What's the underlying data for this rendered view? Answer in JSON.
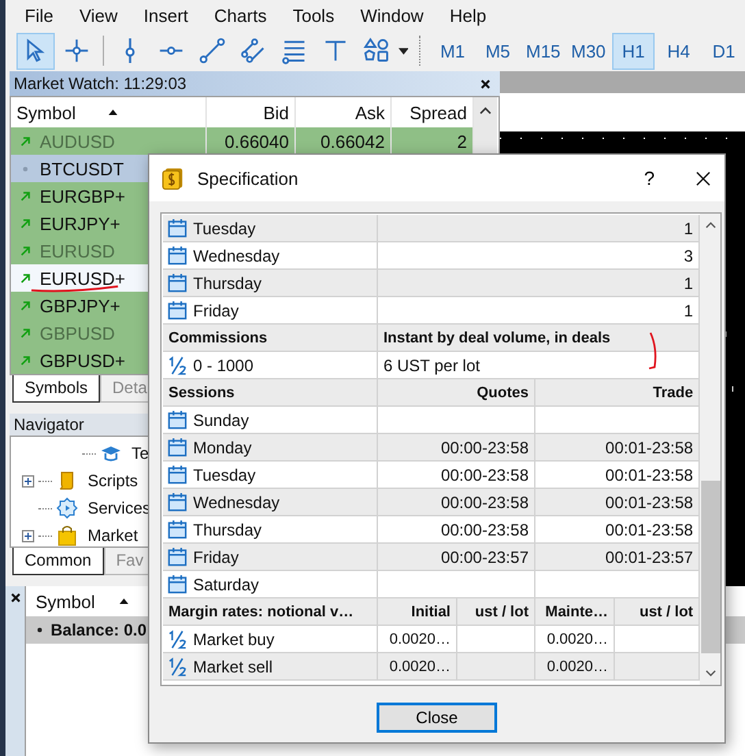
{
  "menu": [
    "File",
    "View",
    "Insert",
    "Charts",
    "Tools",
    "Window",
    "Help"
  ],
  "toolbar": {
    "tools": [
      {
        "kind": "cursor",
        "selected": true
      },
      {
        "kind": "crosshair",
        "selected": false
      },
      {
        "kind": "vline",
        "selected": false
      },
      {
        "kind": "hline",
        "selected": false
      },
      {
        "kind": "trend",
        "selected": false
      },
      {
        "kind": "channel",
        "selected": false
      },
      {
        "kind": "levels",
        "selected": false
      },
      {
        "kind": "text",
        "selected": false
      },
      {
        "kind": "shapes",
        "selected": false
      }
    ],
    "timeframes": [
      {
        "label": "M1",
        "selected": false
      },
      {
        "label": "M5",
        "selected": false
      },
      {
        "label": "M15",
        "selected": false
      },
      {
        "label": "M30",
        "selected": false
      },
      {
        "label": "H1",
        "selected": true
      },
      {
        "label": "H4",
        "selected": false
      },
      {
        "label": "D1",
        "selected": false
      }
    ]
  },
  "market_watch": {
    "title": "Market Watch: 11:29:03",
    "columns": [
      "Symbol",
      "Bid",
      "Ask",
      "Spread"
    ],
    "rows": [
      {
        "symbol": "AUDUSD",
        "kind": "up",
        "disabled": true,
        "color": "#8fbf86",
        "bid": "0.66040",
        "ask": "0.66042",
        "spread": "2"
      },
      {
        "symbol": "BTCUSDT",
        "kind": "dot",
        "disabled": false,
        "color": "#b7c9df"
      },
      {
        "symbol": "EURGBP+",
        "kind": "up",
        "disabled": false,
        "color": "#8fbf86"
      },
      {
        "symbol": "EURJPY+",
        "kind": "up",
        "disabled": false,
        "color": "#8fbf86"
      },
      {
        "symbol": "EURUSD",
        "kind": "up",
        "disabled": true,
        "color": "#8fbf86"
      },
      {
        "symbol": "EURUSD+",
        "kind": "up",
        "disabled": false,
        "color": "#f3f7fc",
        "annotated": true
      },
      {
        "symbol": "GBPJPY+",
        "kind": "up",
        "disabled": false,
        "color": "#8fbf86"
      },
      {
        "symbol": "GBPUSD",
        "kind": "up",
        "disabled": true,
        "color": "#8fbf86"
      },
      {
        "symbol": "GBPUSD+",
        "kind": "up",
        "disabled": false,
        "color": "#8fbf86"
      }
    ],
    "tabs": [
      {
        "label": "Symbols",
        "selected": true
      },
      {
        "label": "Deta",
        "selected": false
      }
    ]
  },
  "navigator": {
    "title": "Navigator",
    "items": [
      {
        "label": "Te",
        "kind": "cap"
      },
      {
        "label": "Scripts",
        "kind": "scroll",
        "expanded": false
      },
      {
        "label": "Services",
        "kind": "gear"
      },
      {
        "label": "Market",
        "kind": "bag",
        "expanded": false
      }
    ],
    "tabs": [
      {
        "label": "Common",
        "selected": true
      },
      {
        "label": "Fav",
        "selected": false
      }
    ]
  },
  "toolbox": {
    "columns": [
      "Symbol"
    ],
    "rows": [
      "Balance: 0.0"
    ]
  },
  "dialog": {
    "title": "Specification",
    "help": "?",
    "sections": [
      {
        "kind": "schedule",
        "rows": [
          {
            "label": "Tuesday",
            "values": [
              "1"
            ]
          },
          {
            "label": "Wednesday",
            "values": [
              "3"
            ]
          },
          {
            "label": "Thursday",
            "values": [
              "1"
            ]
          },
          {
            "label": "Friday",
            "values": [
              "1"
            ]
          }
        ]
      },
      {
        "kind": "commissions",
        "heading": [
          "Commissions",
          "Instant by deal volume, in deals"
        ],
        "annotated": true,
        "rows": [
          {
            "label": "0 - 1000",
            "values": [
              "6 UST per lot"
            ]
          }
        ]
      },
      {
        "kind": "sessions",
        "heading": [
          "Sessions",
          "Quotes",
          "Trade"
        ],
        "rows": [
          {
            "label": "Sunday"
          },
          {
            "label": "Monday",
            "values": [
              "00:00-23:58",
              "00:01-23:58"
            ]
          },
          {
            "label": "Tuesday",
            "values": [
              "00:00-23:58",
              "00:01-23:58"
            ]
          },
          {
            "label": "Wednesday",
            "values": [
              "00:00-23:58",
              "00:01-23:58"
            ]
          },
          {
            "label": "Thursday",
            "values": [
              "00:00-23:58",
              "00:01-23:58"
            ]
          },
          {
            "label": "Friday",
            "values": [
              "00:00-23:57",
              "00:01-23:57"
            ]
          },
          {
            "label": "Saturday"
          }
        ]
      },
      {
        "kind": "margin",
        "heading": [
          "Margin rates: notional v…",
          "Initial",
          "ust / lot",
          "Mainte…",
          "ust / lot"
        ],
        "rows": [
          {
            "label": "Market buy",
            "initial": "0.0020…",
            "maintenance": "0.0020…"
          },
          {
            "label": "Market sell",
            "initial": "0.0020…",
            "maintenance": "0.0020…"
          }
        ]
      }
    ],
    "button": "Close"
  }
}
